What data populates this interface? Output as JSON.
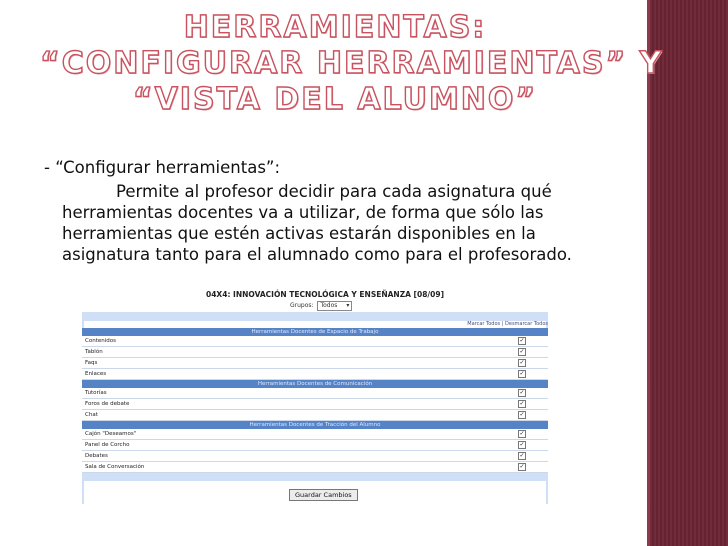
{
  "title": {
    "line1": "HERRAMIENTAS:",
    "line2": "“CONFIGURAR HERRAMIENTAS” Y",
    "line3": "“VISTA DEL ALUMNO”"
  },
  "bullet": "- “Configurar herramientas”:",
  "paragraph": "Permite al profesor decidir para cada asignatura qué herramientas docentes va a utilizar, de forma que sólo las herramientas que estén activas estarán disponibles en la asignatura tanto para el alumnado como para el profesorado.",
  "screenshot": {
    "course_title": "04X4: INNOVACIÓN TECNOLÓGICA Y ENSEÑANZA [08/09]",
    "group_label": "Grupos:",
    "group_value": "Todos",
    "marcar_todos": "Marcar Todos",
    "separator": "|",
    "desmarcar_todos": "Desmarcar Todos",
    "sections": [
      {
        "header": "Herramientas Docentes de Espacio de Trabajo",
        "items": [
          "Contenidos",
          "Tablón",
          "Faqs",
          "Enlaces"
        ]
      },
      {
        "header": "Herramientas Docentes de Comunicación",
        "items": [
          "Tutorías",
          "Foros de debate",
          "Chat"
        ]
      },
      {
        "header": "Herramientas Docentes de Tracción del Alumno",
        "items": [
          "Cajón \"Deseamos\"",
          "Panel de Corcho",
          "Debates",
          "Sala de Conversación"
        ]
      }
    ],
    "check_mark": "✓",
    "save_button": "Guardar Cambios"
  }
}
